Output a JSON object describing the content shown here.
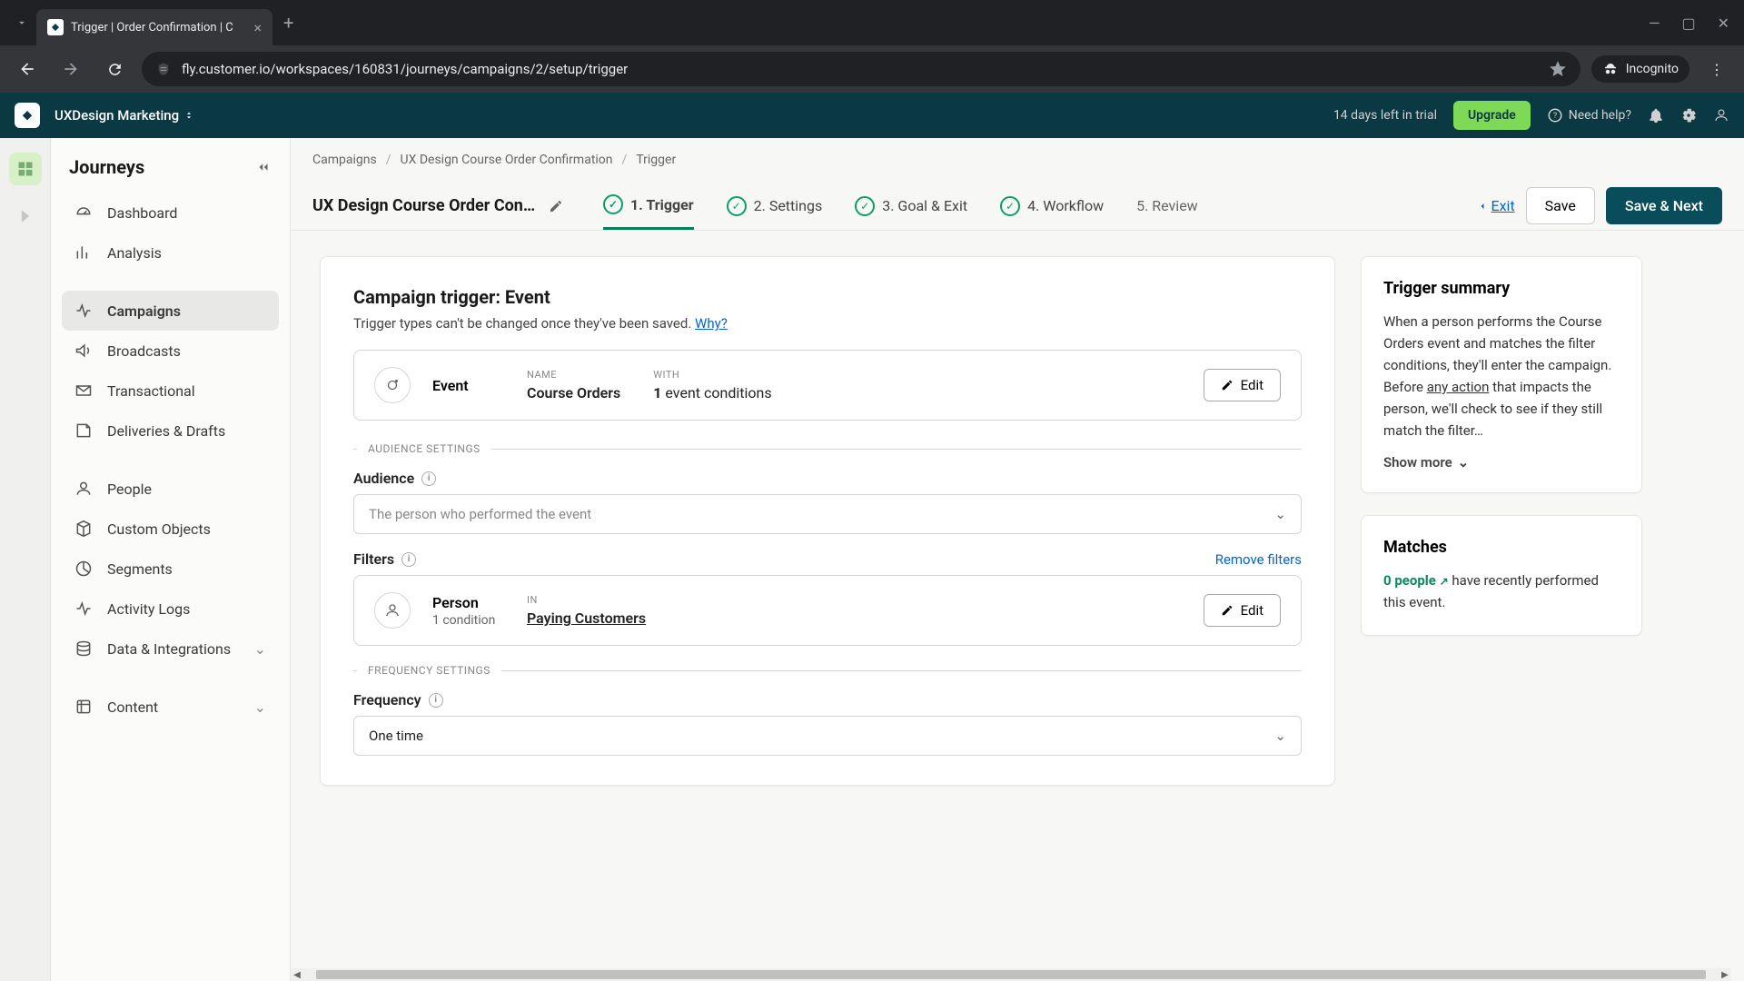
{
  "browser": {
    "tab_title": "Trigger | Order Confirmation | C",
    "url": "fly.customer.io/workspaces/160831/journeys/campaigns/2/setup/trigger",
    "incognito": "Incognito"
  },
  "header": {
    "workspace": "UXDesign Marketing",
    "trial": "14 days left in trial",
    "upgrade": "Upgrade",
    "need_help": "Need help?"
  },
  "sidebar": {
    "title": "Journeys",
    "items": [
      {
        "label": "Dashboard"
      },
      {
        "label": "Analysis"
      },
      {
        "label": "Campaigns"
      },
      {
        "label": "Broadcasts"
      },
      {
        "label": "Transactional"
      },
      {
        "label": "Deliveries & Drafts"
      },
      {
        "label": "People"
      },
      {
        "label": "Custom Objects"
      },
      {
        "label": "Segments"
      },
      {
        "label": "Activity Logs"
      },
      {
        "label": "Data & Integrations"
      },
      {
        "label": "Content"
      }
    ]
  },
  "breadcrumbs": {
    "a": "Campaigns",
    "b": "UX Design Course Order Confirmation",
    "c": "Trigger"
  },
  "campaign": {
    "name": "UX Design Course Order Confi…"
  },
  "steps": {
    "s1": "1. Trigger",
    "s2": "2. Settings",
    "s3": "3. Goal & Exit",
    "s4": "4. Workflow",
    "s5": "5. Review"
  },
  "actions": {
    "exit": "Exit",
    "save": "Save",
    "save_next": "Save & Next",
    "edit": "Edit",
    "remove_filters": "Remove filters",
    "show_more": "Show more"
  },
  "trigger": {
    "title": "Campaign trigger: Event",
    "subtitle_a": "Trigger types can't be changed once they've been saved. ",
    "why": "Why?",
    "event_label": "Event",
    "name_label": "NAME",
    "name_value": "Course Orders",
    "with_label": "WITH",
    "with_count": "1",
    "with_text": " event conditions",
    "audience_divider": "AUDIENCE SETTINGS",
    "audience_label": "Audience",
    "audience_placeholder": "The person who performed the event",
    "filters_label": "Filters",
    "person_label": "Person",
    "person_sub": "1 condition",
    "in_label": "IN",
    "segment": "Paying Customers",
    "frequency_divider": "FREQUENCY SETTINGS",
    "frequency_label": "Frequency",
    "frequency_value": "One time"
  },
  "summary": {
    "title": "Trigger summary",
    "text_a": "When a person performs the Course Orders event and matches the filter conditions, they'll enter the campaign. Before ",
    "any_action": "any action",
    "text_b": " that impacts the person, we'll check to see if they still match the filter…"
  },
  "matches": {
    "title": "Matches",
    "count": "0 people",
    "text": " have recently performed this event."
  }
}
